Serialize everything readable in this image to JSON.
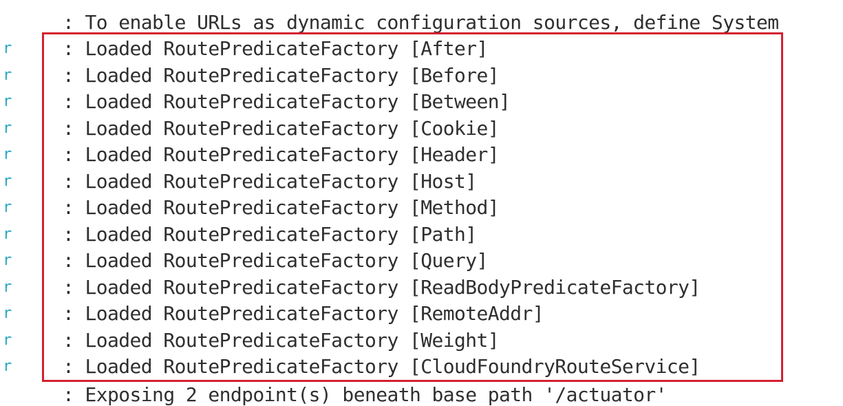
{
  "header_fragment": "",
  "top_line": ": To enable URLs as dynamic configuration sources, define System",
  "gutter_glyph": "r",
  "loaded_lines": [
    ": Loaded RoutePredicateFactory [After]",
    ": Loaded RoutePredicateFactory [Before]",
    ": Loaded RoutePredicateFactory [Between]",
    ": Loaded RoutePredicateFactory [Cookie]",
    ": Loaded RoutePredicateFactory [Header]",
    ": Loaded RoutePredicateFactory [Host]",
    ": Loaded RoutePredicateFactory [Method]",
    ": Loaded RoutePredicateFactory [Path]",
    ": Loaded RoutePredicateFactory [Query]",
    ": Loaded RoutePredicateFactory [ReadBodyPredicateFactory]",
    ": Loaded RoutePredicateFactory [RemoteAddr]",
    ": Loaded RoutePredicateFactory [Weight]",
    ": Loaded RoutePredicateFactory [CloudFoundryRouteService]"
  ],
  "bottom_line": ": Exposing 2 endpoint(s) beneath base path '/actuator'",
  "colors": {
    "highlight_border": "#d4202f",
    "gutter": "#29a8c4",
    "text": "#2f2f2f",
    "background": "#ffffff"
  }
}
